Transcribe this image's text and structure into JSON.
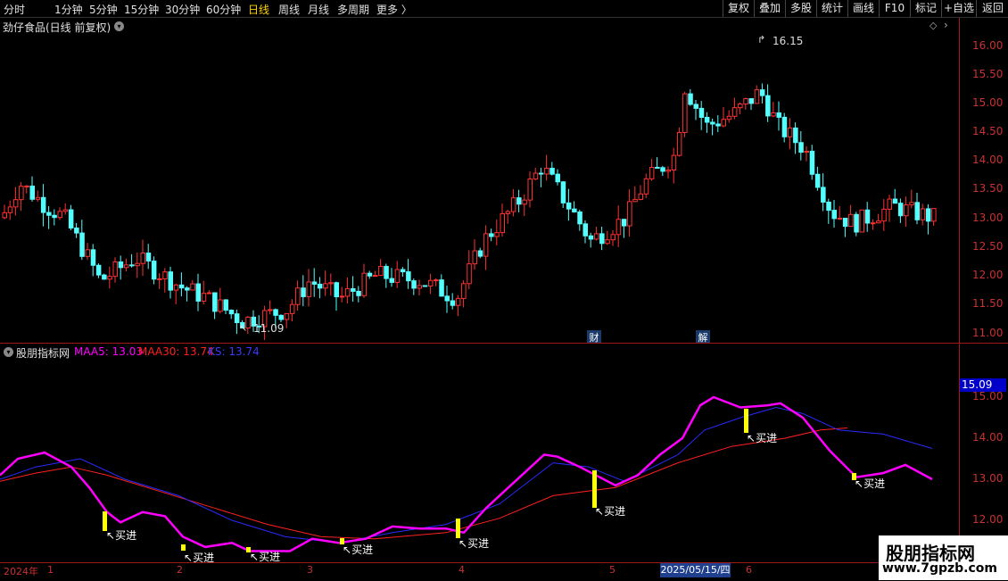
{
  "toolbar": {
    "periods": [
      "分时",
      "1分钟",
      "5分钟",
      "15分钟",
      "30分钟",
      "60分钟",
      "日线",
      "周线",
      "月线",
      "多周期",
      "更多 〉"
    ],
    "active_period": "日线",
    "buttons": [
      "复权",
      "叠加",
      "多股",
      "统计",
      "画线",
      "F10",
      "标记",
      "+自选",
      "返回"
    ]
  },
  "main_chart": {
    "stock_title": "劲仔食品(日线 前复权)",
    "high_label": "16.15",
    "low_label": "11.09",
    "marker_fin": "财",
    "marker_unlock": "解",
    "y_ticks": [
      "16.00",
      "15.50",
      "15.00",
      "14.50",
      "14.00",
      "13.50",
      "13.00",
      "12.50",
      "12.00",
      "11.50",
      "11.00"
    ]
  },
  "indicator": {
    "name": "股朋指标网",
    "maa5_label": "MAA5: 13.03",
    "maa30_label": "MAA30: 13.74",
    "ks_label": "KS: 13.74",
    "current_value": "15.09",
    "y_ticks": [
      "15.00",
      "14.00",
      "13.00",
      "12.00"
    ],
    "buy_label": "买进"
  },
  "x_axis": {
    "labels": [
      "2024年",
      "1",
      "2",
      "3",
      "4",
      "5",
      "6"
    ],
    "cursor_date": "2025/05/15/四"
  },
  "watermark": {
    "title": "股朋指标网",
    "url": "www.7gpzb.com"
  },
  "colors": {
    "up": "#ff3232",
    "down": "#54ffff",
    "maa5": "#ff00ff",
    "maa30": "#ff2020",
    "ks": "#2a2aff",
    "buy_bar": "#ffff00",
    "axis": "#c83232"
  }
}
